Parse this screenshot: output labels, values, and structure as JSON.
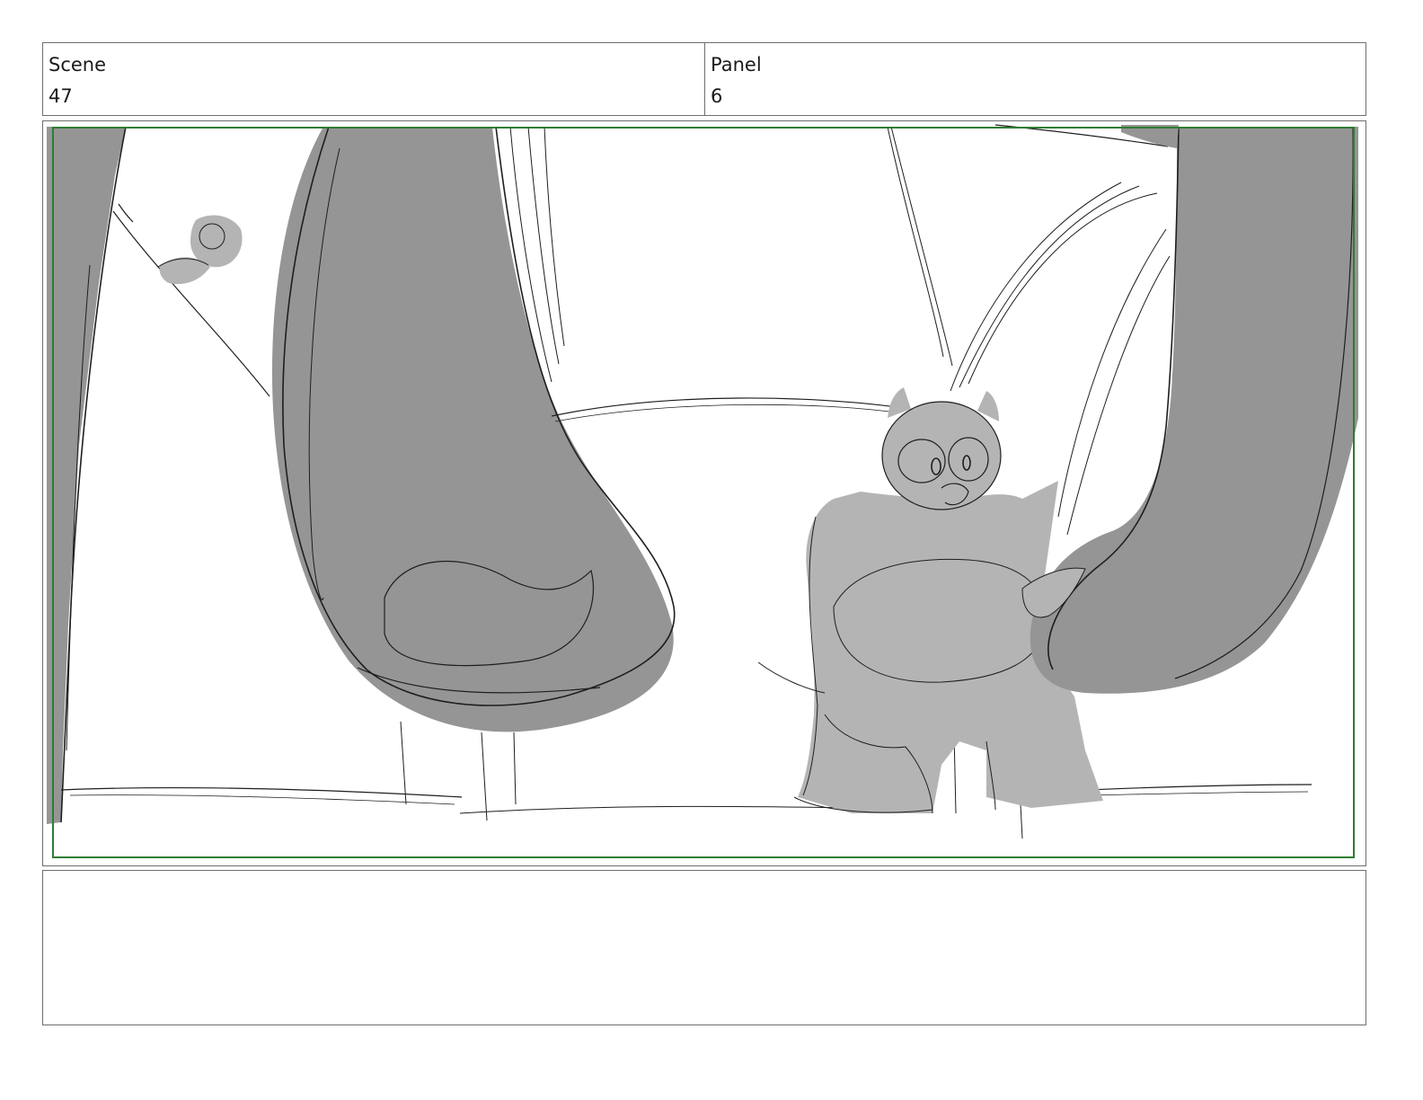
{
  "header": {
    "scene_label": "Scene",
    "scene_number": "47",
    "panel_label": "Panel",
    "panel_number": "6"
  },
  "frame": {
    "safe_area_color": "#2e7d32",
    "dark_fill_color": "#959595",
    "light_fill_color": "#b4b4b4",
    "sketch_line_color": "#1e1e1e"
  },
  "notes": {
    "text": ""
  }
}
